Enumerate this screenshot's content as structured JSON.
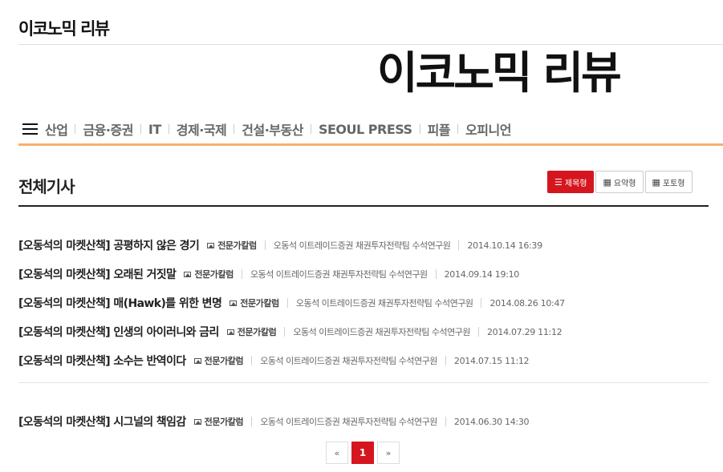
{
  "header": {
    "small_logo": "이코노믹 리뷰",
    "big_logo": "이코노믹 리뷰"
  },
  "nav": {
    "menu_icon": "hamburger-icon",
    "items": [
      "산업",
      "금융·증권",
      "IT",
      "경제·국제",
      "건설·부동산",
      "SEOUL PRESS",
      "피플",
      "오피니언"
    ]
  },
  "section": {
    "title": "전체기사",
    "views": [
      {
        "label": "제목형",
        "icon": "list-icon",
        "active": true
      },
      {
        "label": "요약형",
        "icon": "grid-icon",
        "active": false
      },
      {
        "label": "포토형",
        "icon": "grid-icon",
        "active": false
      }
    ]
  },
  "articles": [
    {
      "title": "[오동석의 마켓산책] 공평하지 않은 경기",
      "category": "전문가칼럼",
      "author": "오동석 이트레이드증권 채권투자전략팀 수석연구원",
      "date": "2014.10.14 16:39"
    },
    {
      "title": "[오동석의 마켓산책] 오래된 거짓말",
      "category": "전문가칼럼",
      "author": "오동석 이트레이드증권 채권투자전략팀 수석연구원",
      "date": "2014.09.14 19:10"
    },
    {
      "title": "[오동석의 마켓산책] 매(Hawk)를 위한 변명",
      "category": "전문가칼럼",
      "author": "오동석 이트레이드증권 채권투자전략팀 수석연구원",
      "date": "2014.08.26 10:47"
    },
    {
      "title": "[오동석의 마켓산책] 인생의 아이러니와 금리",
      "category": "전문가칼럼",
      "author": "오동석 이트레이드증권 채권투자전략팀 수석연구원",
      "date": "2014.07.29 11:12"
    },
    {
      "title": "[오동석의 마켓산책] 소수는 반역이다",
      "category": "전문가칼럼",
      "author": "오동석 이트레이드증권 채권투자전략팀 수석연구원",
      "date": "2014.07.15 11:12"
    },
    {
      "title": "[오동석의 마켓산책] 시그널의 책임감",
      "category": "전문가칼럼",
      "author": "오동석 이트레이드증권 채권투자전략팀 수석연구원",
      "date": "2014.06.30 14:30"
    }
  ],
  "pagination": {
    "prev": "«",
    "current": "1",
    "next": "»"
  },
  "colors": {
    "accent": "#d5161e",
    "nav_underline": "#f6b16e"
  }
}
